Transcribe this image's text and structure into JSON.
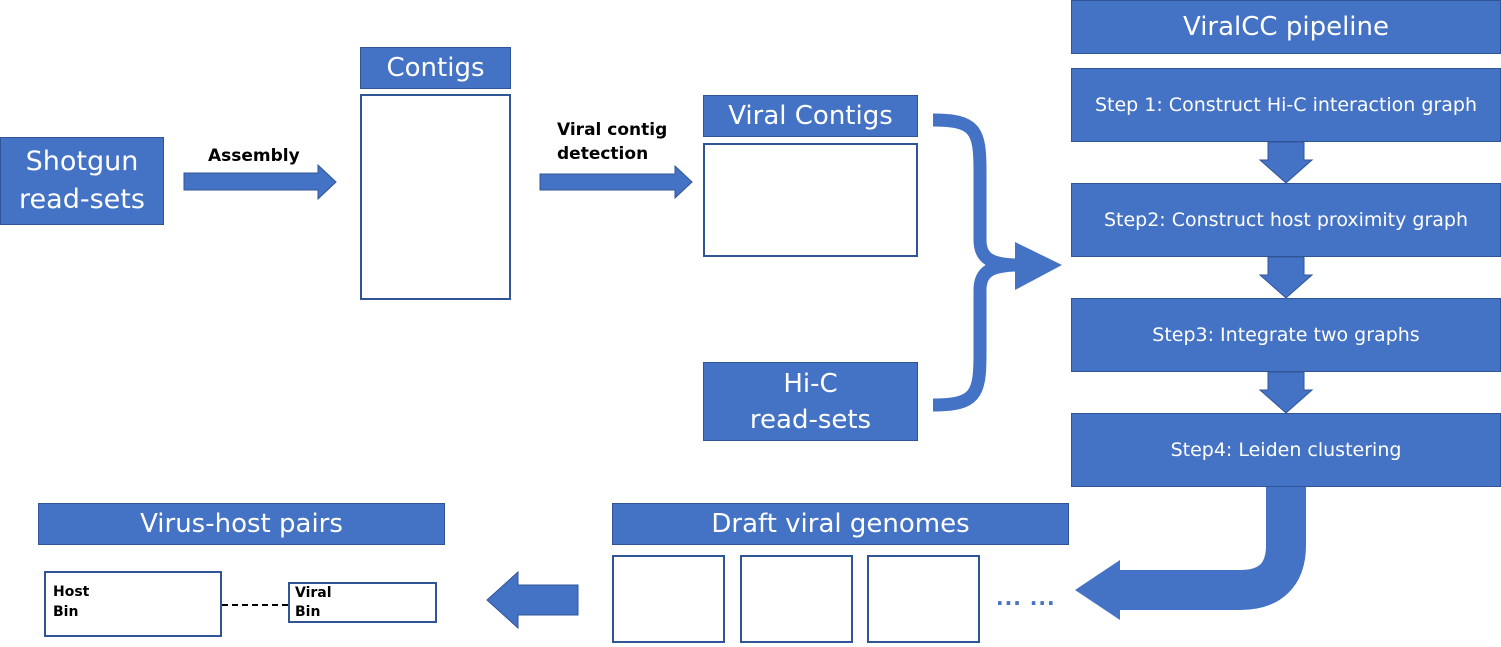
{
  "colors": {
    "box": "#4472C4",
    "border": "#2F5597",
    "purple": "#7030A0",
    "red": "#C0281E",
    "orange": "#F28A3A",
    "green": "#7AB648"
  },
  "shotgun": "Shotgun read-sets",
  "assembly": "Assembly",
  "contigs": "Contigs",
  "detection": "Viral contig detection",
  "viral_contigs": "Viral Contigs",
  "hic": "Hi-C read-sets",
  "pipeline": {
    "title": "ViralCC pipeline",
    "steps": [
      "Step 1: Construct Hi-C interaction graph",
      "Step2: Construct host proximity graph",
      "Step3: Integrate two graphs",
      "Step4: Leiden clustering"
    ]
  },
  "draft": "Draft viral genomes",
  "ellipsis": "... ...",
  "pairs": {
    "title": "Virus-host pairs",
    "host_bin": "Host Bin",
    "viral_bin": "Viral Bin"
  }
}
